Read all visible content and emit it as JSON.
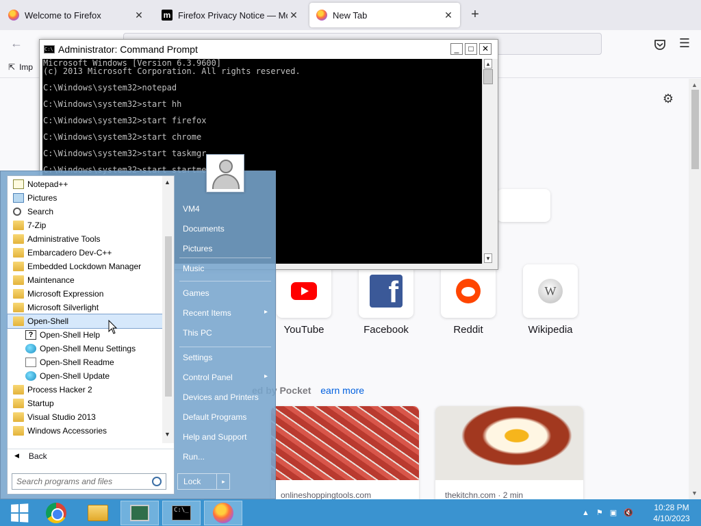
{
  "browser": {
    "tabs": [
      {
        "title": "Welcome to Firefox",
        "icon": "firefox-logo",
        "active": false
      },
      {
        "title": "Firefox Privacy Notice — Mozilla",
        "icon": "mozilla-logo",
        "active": false
      },
      {
        "title": "New Tab",
        "icon": "firefox-logo",
        "active": true
      }
    ],
    "tab_close_glyph": "✕",
    "new_tab_glyph": "+",
    "mozilla_glyph": "m",
    "back_glyph": "←",
    "menu_glyph": "☰",
    "settings_glyph": "⚙",
    "import_label": "Imp",
    "import_glyph": "⇱"
  },
  "newtab": {
    "top_sites": [
      {
        "label": "YouTube",
        "icon": "youtube-logo"
      },
      {
        "label": "Facebook",
        "icon": "facebook-logo"
      },
      {
        "label": "Reddit",
        "icon": "reddit-logo"
      },
      {
        "label": "Wikipedia",
        "icon": "wikipedia-logo"
      }
    ],
    "facebook_glyph": "f",
    "wikipedia_glyph": "W",
    "pocket_text": "ed by Pocket",
    "learn_more": "earn more",
    "stories": [
      {
        "source": "onlineshoppingtools.com",
        "image": "ground-meat-photo"
      },
      {
        "source": "thekitchn.com · 2 min",
        "image": "eggs-bacon-photo"
      }
    ]
  },
  "cmd": {
    "title": "Administrator:  Command Prompt",
    "icon_text": "C:\\",
    "lines": [
      "Microsoft Windows [Version 6.3.9600]",
      "(c) 2013 Microsoft Corporation. All rights reserved.",
      "",
      "C:\\Windows\\system32>notepad",
      "",
      "C:\\Windows\\system32>start hh",
      "",
      "C:\\Windows\\system32>start firefox",
      "",
      "C:\\Windows\\system32>start chrome",
      "",
      "C:\\Windows\\system32>start taskmgr",
      "",
      "C:\\Windows\\system32>start startmenu"
    ],
    "minimize_glyph": "_",
    "maximize_glyph": "□",
    "close_glyph": "✕",
    "scroll_up_glyph": "▲",
    "scroll_down_glyph": "▼"
  },
  "startmenu": {
    "programs": [
      {
        "label": "Notepad++",
        "icon": "notepad-icon",
        "sub": false,
        "highlight": false
      },
      {
        "label": "Pictures",
        "icon": "pictures-icon",
        "sub": false,
        "highlight": false
      },
      {
        "label": "Search",
        "icon": "search-icon",
        "sub": false,
        "highlight": false
      },
      {
        "label": "7-Zip",
        "icon": "folder-icon",
        "sub": false,
        "highlight": false
      },
      {
        "label": "Administrative Tools",
        "icon": "folder-icon",
        "sub": false,
        "highlight": false
      },
      {
        "label": "Embarcadero Dev-C++",
        "icon": "folder-icon",
        "sub": false,
        "highlight": false
      },
      {
        "label": "Embedded Lockdown Manager",
        "icon": "folder-icon",
        "sub": false,
        "highlight": false
      },
      {
        "label": "Maintenance",
        "icon": "folder-icon",
        "sub": false,
        "highlight": false
      },
      {
        "label": "Microsoft Expression",
        "icon": "folder-icon",
        "sub": false,
        "highlight": false
      },
      {
        "label": "Microsoft Silverlight",
        "icon": "folder-icon",
        "sub": false,
        "highlight": false
      },
      {
        "label": "Open-Shell",
        "icon": "folder-icon",
        "sub": false,
        "highlight": true
      },
      {
        "label": "Open-Shell Help",
        "icon": "help-icon",
        "sub": true,
        "highlight": false
      },
      {
        "label": "Open-Shell Menu Settings",
        "icon": "globe-icon",
        "sub": true,
        "highlight": false
      },
      {
        "label": "Open-Shell Readme",
        "icon": "document-icon",
        "sub": true,
        "highlight": false
      },
      {
        "label": "Open-Shell Update",
        "icon": "globe-icon",
        "sub": true,
        "highlight": false
      },
      {
        "label": "Process Hacker 2",
        "icon": "folder-icon",
        "sub": false,
        "highlight": false
      },
      {
        "label": "Startup",
        "icon": "folder-icon",
        "sub": false,
        "highlight": false
      },
      {
        "label": "Visual Studio 2013",
        "icon": "folder-icon",
        "sub": false,
        "highlight": false
      },
      {
        "label": "Windows Accessories",
        "icon": "folder-icon",
        "sub": false,
        "highlight": false
      }
    ],
    "help_glyph": "?",
    "scroll_up_glyph": "▲",
    "scroll_down_glyph": "▼",
    "back_glyph": "◀",
    "back_label": "Back",
    "search_placeholder": "Search programs and files",
    "places": [
      {
        "label": "VM4",
        "submenu": false
      },
      {
        "label": "Documents",
        "submenu": false
      },
      {
        "label": "Pictures",
        "submenu": false
      },
      {
        "label": "Music",
        "submenu": false
      },
      {
        "label": "Games",
        "submenu": false
      },
      {
        "label": "Recent Items",
        "submenu": true
      },
      {
        "label": "This PC",
        "submenu": false
      },
      {
        "label": "Settings",
        "submenu": false
      },
      {
        "label": "Control Panel",
        "submenu": true
      },
      {
        "label": "Devices and Printers",
        "submenu": false
      },
      {
        "label": "Default Programs",
        "submenu": false
      },
      {
        "label": "Help and Support",
        "submenu": false
      },
      {
        "label": "Run...",
        "submenu": false
      }
    ],
    "lock_label": "Lock",
    "lock_arrow_glyph": "▸"
  },
  "taskbar": {
    "apps": [
      {
        "name": "start-button",
        "icon": "windows-logo"
      },
      {
        "name": "chrome-button",
        "icon": "chrome-icon"
      },
      {
        "name": "file-explorer-button",
        "icon": "folder-icon"
      },
      {
        "name": "task-manager-button",
        "icon": "task-manager-icon"
      },
      {
        "name": "command-prompt-button",
        "icon": "cmd-icon"
      },
      {
        "name": "firefox-button",
        "icon": "firefox-icon"
      }
    ],
    "cmd_icon_text": "C:\\_",
    "tray_glyphs": {
      "show_hidden": "▲",
      "flag": "⚑",
      "network": "▣",
      "volume": "🔇"
    },
    "time": "10:28 PM",
    "date": "4/10/2023"
  }
}
